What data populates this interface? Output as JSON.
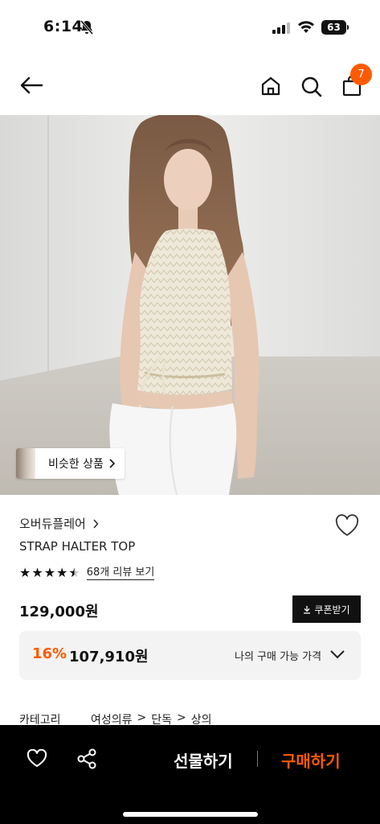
{
  "status_bar": {
    "time": "6:14",
    "battery": "63"
  },
  "nav": {
    "cart_count": "7"
  },
  "similar_products": {
    "label": "비슷한 상품"
  },
  "product": {
    "brand": "오버듀플레어",
    "name": "STRAP HALTER TOP",
    "rating": 4.5,
    "review_link": "68개 리뷰 보기",
    "price": "129,000원",
    "coupon_button": "쿠폰받기"
  },
  "my_price": {
    "discount_rate": "16%",
    "discount_price": "107,910원",
    "label": "나의 구매 가능 가격"
  },
  "category": {
    "label": "카테고리",
    "path": [
      "여성의류",
      "단독",
      "상의"
    ]
  },
  "bottom_bar": {
    "gift_button": "선물하기",
    "buy_button": "구매하기"
  },
  "colors": {
    "accent": "#ff5a00",
    "bottom_bar": "#000000",
    "price_box": "#f3f3f3"
  }
}
